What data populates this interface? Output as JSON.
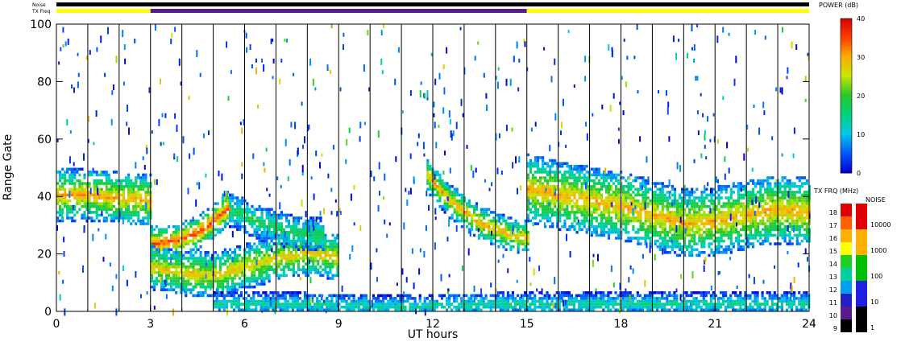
{
  "chart_data": {
    "type": "heatmap",
    "xlabel": "UT hours",
    "ylabel": "Range Gate",
    "xlim": [
      0,
      24
    ],
    "ylim": [
      0,
      100
    ],
    "x_ticks": [
      "0",
      "3",
      "6",
      "9",
      "12",
      "15",
      "18",
      "21",
      "24"
    ],
    "y_ticks": [
      "0",
      "20",
      "40",
      "60",
      "80",
      "100"
    ],
    "status_bars": [
      {
        "label": "Noise",
        "segments": [
          {
            "from": 0,
            "to": 24,
            "color": "#000000"
          }
        ]
      },
      {
        "label": "TX Freq",
        "segments": [
          {
            "from": 0,
            "to": 3,
            "color": "#ffff00"
          },
          {
            "from": 3,
            "to": 15,
            "color": "#5a1a8a"
          },
          {
            "from": 15,
            "to": 24,
            "color": "#ffff00"
          }
        ]
      }
    ],
    "scan_boundaries_ut": [
      1,
      2,
      3,
      4,
      5,
      6,
      7,
      8,
      9,
      10,
      11,
      12,
      13,
      14,
      15,
      16,
      17,
      18,
      19,
      20,
      21,
      22,
      23
    ],
    "echo_bands": [
      {
        "t": [
          0,
          1,
          2,
          3
        ],
        "center": [
          40,
          40,
          39,
          38
        ],
        "width": 9,
        "peak_power": 30
      },
      {
        "t": [
          3,
          3.8,
          4.5,
          5,
          5.5
        ],
        "center": [
          23,
          24,
          27,
          31,
          36
        ],
        "width": 6,
        "peak_power": 35
      },
      {
        "t": [
          3,
          4,
          5,
          6,
          7,
          8,
          9
        ],
        "center": [
          15,
          13,
          12,
          15,
          18,
          20,
          18
        ],
        "width": 8,
        "peak_power": 28
      },
      {
        "t": [
          5.5,
          6.5,
          7.5,
          8.5
        ],
        "center": [
          35,
          30,
          27,
          26
        ],
        "width": 6,
        "peak_power": 18
      },
      {
        "t": [
          11.8,
          12.5,
          13.5,
          14.5,
          15
        ],
        "center": [
          47,
          38,
          30,
          26,
          25
        ],
        "width": 6,
        "peak_power": 30
      },
      {
        "t": [
          15,
          16,
          17,
          18,
          19,
          20,
          21,
          22,
          23,
          24
        ],
        "center": [
          42,
          40,
          38,
          36,
          33,
          30,
          31,
          33,
          35,
          34
        ],
        "width": 12,
        "peak_power": 30
      },
      {
        "t": [
          5,
          8,
          11,
          14,
          17,
          20,
          24
        ],
        "center": [
          2,
          2,
          1,
          2,
          2,
          2,
          2
        ],
        "width": 4,
        "peak_power": 14
      }
    ],
    "power_colorbar": {
      "title": "POWER (dB)",
      "range": [
        0,
        40
      ],
      "ticks": [
        "0",
        "10",
        "20",
        "30",
        "40"
      ]
    },
    "txfreq_colorbar": {
      "title": "TX FRQ (MHz)",
      "levels": [
        "9",
        "10",
        "11",
        "12",
        "13",
        "14",
        "15",
        "16",
        "17",
        "18"
      ],
      "colors": [
        "#000000",
        "#5a1a8a",
        "#2020c8",
        "#00a0f0",
        "#00d0a0",
        "#20d020",
        "#ffff00",
        "#ffb000",
        "#ff6000",
        "#e00000"
      ]
    },
    "noise_colorbar": {
      "title": "NOISE",
      "levels": [
        "1",
        "10",
        "100",
        "1000",
        "10000"
      ],
      "colors": [
        "#000000",
        "#2020e0",
        "#00c000",
        "#ffb000",
        "#e00000"
      ]
    }
  }
}
